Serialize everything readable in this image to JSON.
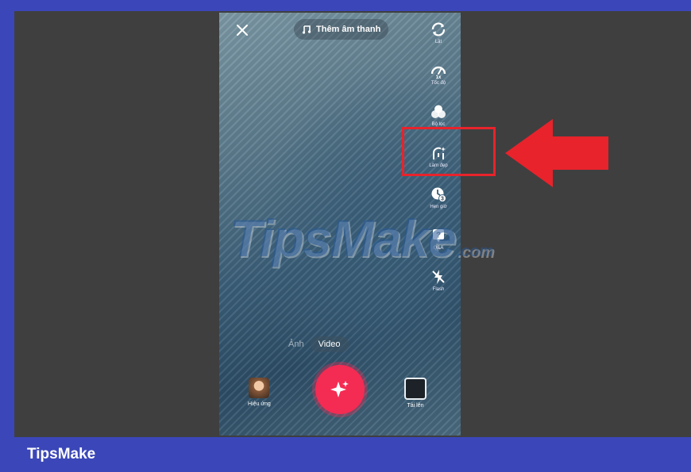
{
  "camera": {
    "add_sound_label": "Thêm âm thanh",
    "tools": [
      {
        "icon": "flip-icon",
        "label": "Lật"
      },
      {
        "icon": "speed-icon",
        "badge": "1x",
        "label": "Tốc độ"
      },
      {
        "icon": "filter-icon",
        "label": "Bộ lọc"
      },
      {
        "icon": "beautify-icon",
        "label": "Làm đẹp"
      },
      {
        "icon": "timer-icon",
        "badge": "3",
        "label": "Hẹn giờ"
      },
      {
        "icon": "qa-icon",
        "label": "Q&A"
      },
      {
        "icon": "flash-icon",
        "label": "Flash"
      }
    ],
    "modes": [
      "Ảnh",
      "Video"
    ],
    "active_mode": "Video",
    "effects_label": "Hiệu ứng",
    "upload_label": "Tải lên"
  },
  "watermark": {
    "text": "TipsMake",
    "domain": ".com"
  },
  "footer": {
    "brand": "TipsMake"
  },
  "colors": {
    "highlight": "#e8232b",
    "record": "#f42b53",
    "footer": "#3b47b8"
  }
}
